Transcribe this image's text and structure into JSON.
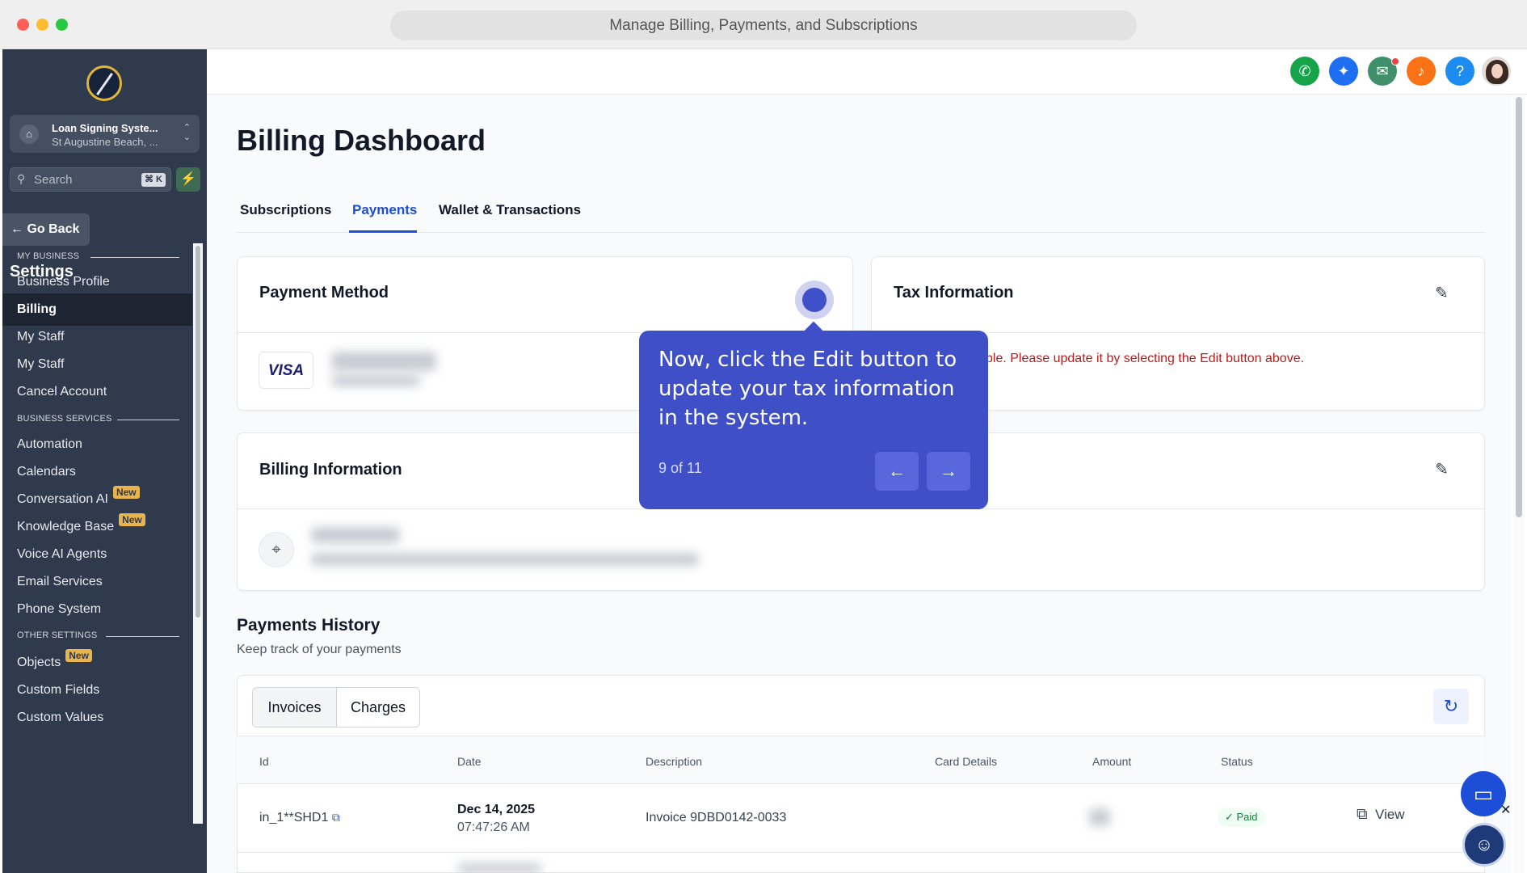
{
  "browser": {
    "title": "Manage Billing, Payments, and Subscriptions"
  },
  "sidebar": {
    "account_name": "Loan Signing Syste...",
    "account_location": "St Augustine Beach, ...",
    "search_placeholder": "Search",
    "search_shortcut": "⌘ K",
    "go_back": "Go Back",
    "settings_title": "Settings",
    "sections": [
      "MY BUSINESS",
      "BUSINESS SERVICES",
      "OTHER SETTINGS"
    ],
    "items": [
      {
        "label": "Business Profile"
      },
      {
        "label": "Billing",
        "active": true
      },
      {
        "label": "My Staff"
      },
      {
        "label": "My Staff"
      },
      {
        "label": "Cancel Account"
      },
      {
        "label": "Automation"
      },
      {
        "label": "Calendars"
      },
      {
        "label": "Conversation AI",
        "badge": "New"
      },
      {
        "label": "Knowledge Base",
        "badge": "New"
      },
      {
        "label": "Voice AI Agents"
      },
      {
        "label": "Email Services"
      },
      {
        "label": "Phone System"
      },
      {
        "label": "Objects",
        "badge": "New"
      },
      {
        "label": "Custom Fields"
      },
      {
        "label": "Custom Values"
      }
    ]
  },
  "topbar": {
    "icons": [
      "phone-icon",
      "sparkle-icon",
      "megaphone-icon",
      "bell-icon",
      "help-icon"
    ],
    "colors": {
      "phone": "#16a34a",
      "sparkle": "#1d6ef0",
      "megaphone": "#3f8f6a",
      "bell": "#f97316",
      "help": "#1d8cf0"
    }
  },
  "page": {
    "title": "Billing Dashboard",
    "tabs": [
      "Subscriptions",
      "Payments",
      "Wallet & Transactions"
    ],
    "active_tab": "Payments"
  },
  "payment_method": {
    "title": "Payment Method",
    "card_brand": "VISA"
  },
  "tax_information": {
    "title": "Tax Information",
    "message": "ble. Please update it by selecting the Edit button above."
  },
  "billing_information": {
    "title": "Billing Information"
  },
  "payments_history": {
    "title": "Payments History",
    "subtitle": "Keep track of your payments",
    "segments": [
      "Invoices",
      "Charges"
    ],
    "columns": [
      "Id",
      "Date",
      "Description",
      "Card Details",
      "Amount",
      "Status"
    ],
    "rows": [
      {
        "id": "in_1**SHD1",
        "date": "Dec 14, 2025",
        "time": "07:47:26 AM",
        "description": "Invoice 9DBD0142-0033",
        "status": "✓ Paid",
        "action": "View"
      }
    ]
  },
  "tooltip": {
    "text": "Now, click the Edit button to update your tax information in the system.",
    "step": "9 of 11"
  },
  "accent_color": "#3f4fc8"
}
